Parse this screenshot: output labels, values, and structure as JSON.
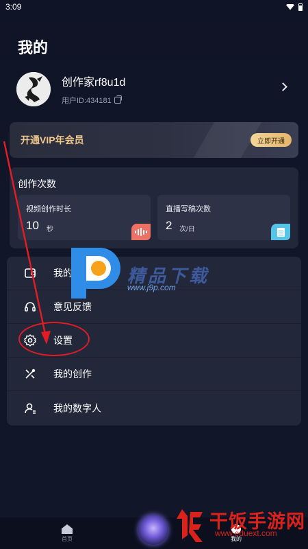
{
  "status_bar": {
    "time": "3:09"
  },
  "page": {
    "title": "我的"
  },
  "profile": {
    "name": "创作家rf8u1d",
    "uid": "用户ID:434181"
  },
  "vip": {
    "label": "开通VIP年会员",
    "button": "立即开通"
  },
  "quota": {
    "title": "创作次数",
    "items": [
      {
        "label": "视频创作时长",
        "value": "10",
        "unit": "秒",
        "icon": "sound-wave-icon"
      },
      {
        "label": "直播写稿次数",
        "value": "2",
        "unit": "次/日",
        "icon": "document-icon"
      }
    ]
  },
  "menu": {
    "items": [
      {
        "label": "我的订单",
        "icon": "wallet-icon"
      },
      {
        "label": "意见反馈",
        "icon": "headset-icon"
      },
      {
        "label": "设置",
        "icon": "gear-icon"
      },
      {
        "label": "我的创作",
        "icon": "edit-tools-icon"
      },
      {
        "label": "我的数字人",
        "icon": "digital-person-icon"
      }
    ]
  },
  "watermark": {
    "brand": "精品下载",
    "url": "www.j9p.com",
    "bottom_brand": "干饭手游网",
    "bottom_url": "www.eduext.com"
  },
  "tab_bar": {
    "home": "首页",
    "mine": "我的"
  },
  "colors": {
    "background": "#111629",
    "card": "#23273a",
    "vip_gold": "#f1c98d",
    "annotation_red": "#e01d24"
  }
}
